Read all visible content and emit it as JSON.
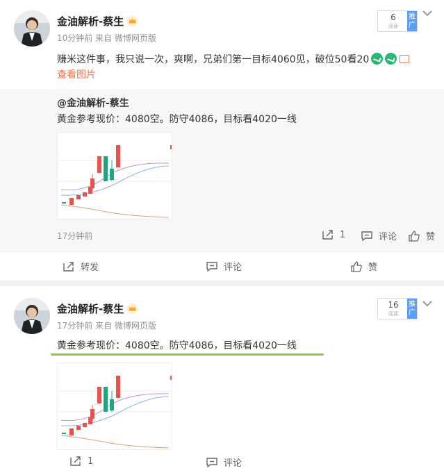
{
  "posts": [
    {
      "username": "金油解析-蔡生",
      "time": "10分钟前",
      "source": "来自 微博网页版",
      "push_count": "6",
      "push_sub": "阅读",
      "push_tag": "推广",
      "text": "赚米这件事，我只说一次，爽啊，兄弟们第一目标4060见，破位50看20",
      "view_pics": "查看图片",
      "repost": {
        "username": "@金油解析-蔡生",
        "text": "黄金参考现价：4080空。防守4086，目标看4020一线",
        "time": "17分钟前",
        "share_count": "1",
        "comment_label": "评论",
        "like_label": "赞"
      },
      "actions": {
        "forward": "转发",
        "comment": "评论",
        "like": "赞"
      }
    },
    {
      "username": "金油解析-蔡生",
      "time": "17分钟前",
      "source": "来自 微博网页版",
      "push_count": "16",
      "push_sub": "阅读",
      "push_tag": "推广",
      "text": "黄金参考现价：4080空。防守4086，目标看4020一线",
      "actions": {
        "share_count": "1",
        "comment": "评论"
      }
    }
  ],
  "colors": {
    "up": "#e8524a",
    "down": "#20a581",
    "link": "#eb7350",
    "highlight": "#8cc63f",
    "push_tag": "#5a9ef5"
  }
}
